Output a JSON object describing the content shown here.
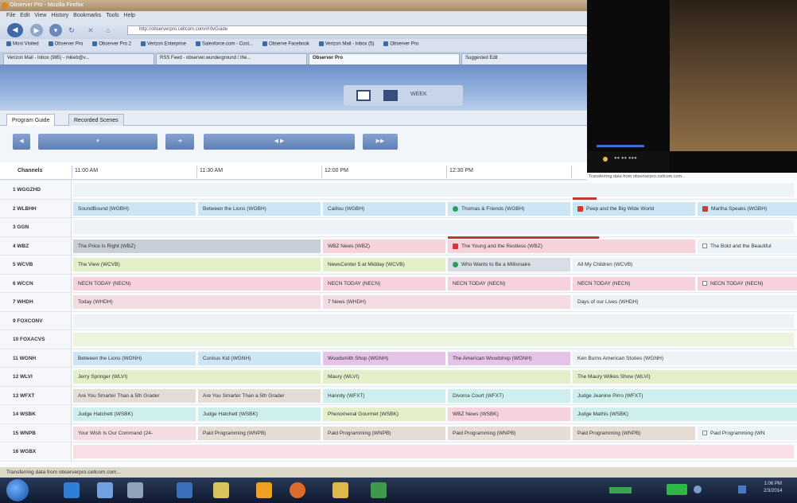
{
  "window": {
    "title": "Observer Pro - Mozilla Firefox"
  },
  "menu": [
    "File",
    "Edit",
    "View",
    "History",
    "Bookmarks",
    "Tools",
    "Help"
  ],
  "nav": {
    "url": "http://observerpro.cellcom.com/#!/tvGuide"
  },
  "bookmarks": [
    "Most Visited",
    "Observer Pro",
    "Observer Pro 2",
    "Verizon Enterprise",
    "Salesforce.com - Cust...",
    "Observe Facebook",
    "Verizon Mail - Inbox (5)",
    "Observer Pro"
  ],
  "tabs": [
    "Verizon Mail - Inbox (985) - mikeb@v...",
    "RSS Feed - observer.wunderground / the...",
    "Observer Pro",
    "Suggested Edit"
  ],
  "app": {
    "view_label": "WEEK"
  },
  "subtabs": [
    "Program Guide",
    "Recorded Scenes"
  ],
  "grid": {
    "channels_header": "Channels",
    "times": [
      "11:00 AM",
      "11:30 AM",
      "12:00 PM",
      "12:30 PM"
    ],
    "rows": [
      {
        "channel": "1 WGGZHD",
        "programs": []
      },
      {
        "channel": "2 WLBHH",
        "programs": [
          "SoundBound (WGBH)",
          "Between the Lions (WGBH)",
          "Caillou (WGBH)",
          "Thomas & Friends (WGBH)",
          "Peep and the Big Wide World",
          "Martha Speaks (WGBH)"
        ]
      },
      {
        "channel": "3 GGN",
        "programs": []
      },
      {
        "channel": "4 WBZ",
        "programs": [
          "The Price Is Right (WBZ)",
          "WBZ News (WBZ)",
          "The Young and the Restless (WBZ)",
          "The Bold and the Beautiful"
        ]
      },
      {
        "channel": "5 WCVB",
        "programs": [
          "The View (WCVB)",
          "NewsCenter 5 at Midday (WCVB)",
          "Who Wants to Be a Millionaire",
          "All My Children (WCVB)"
        ]
      },
      {
        "channel": "6 WCCN",
        "programs": [
          "NECN TODAY (NECN)",
          "NECN TODAY (NECN)",
          "NECN TODAY (NECN)",
          "NECN TODAY (NECN)",
          "NECN TODAY (NECN)"
        ]
      },
      {
        "channel": "7 WHDH",
        "programs": [
          "Today (WHDH)",
          "7 News (WHDH)",
          "Days of our Lives (WHDH)"
        ]
      },
      {
        "channel": "9 FOXCONV",
        "programs": []
      },
      {
        "channel": "10 FOXACVS",
        "programs": []
      },
      {
        "channel": "11 WGNH",
        "programs": [
          "Between the Lions (WGNH)",
          "Curious Kid (WGNH)",
          "Woodsmith Shop (WGNH)",
          "The American Woodshop (WGNH)",
          "Ken Burns American Stories (WGNH)"
        ]
      },
      {
        "channel": "12 WLVI",
        "programs": [
          "Jerry Springer (WLVI)",
          "Maury (WLVI)",
          "The Maury Wilkes Show (WLVI)"
        ]
      },
      {
        "channel": "13 WFXT",
        "programs": [
          "Are You Smarter Than a 5th Grader",
          "Are You Smarter Than a 5th Grader",
          "Hannity (WFXT)",
          "Divorce Court (WFXT)",
          "Judge Jeanine Pirro (WFXT)"
        ]
      },
      {
        "channel": "14 WSBK",
        "programs": [
          "Judge Hatchett (WSBK)",
          "Judge Hatchett (WSBK)",
          "Phenomenal Gourmet (WSBK)",
          "WBZ News (WSBK)",
          "Judge Mathis (WSBK)"
        ]
      },
      {
        "channel": "15 WNPB",
        "programs": [
          "Your Wish Is Our Command (24-",
          "Paid Programming (WNPB)",
          "Paid Programming (WNPB)",
          "Paid Programming (WNPB)",
          "Paid Programming (WNPB)",
          "Paid Programming (WN"
        ]
      },
      {
        "channel": "16 WGBX",
        "programs": []
      }
    ]
  },
  "video": {
    "caption": "Transferring data from observerpro.cellcom.com..."
  },
  "status": "Transferring data from observerpro.cellcom.com...",
  "taskbar": {
    "time": "1:06 PM",
    "date": "2/3/2014"
  },
  "colors": {
    "blue": "#cde6f5",
    "pink": "#f6d3dc",
    "green": "#e2efc9",
    "gray": "#d9dde6",
    "purple": "#e3c3e6",
    "cyan": "#cfeeee",
    "tan": "#e5dcd6",
    "accent": "#3f6aa8",
    "record": "#2f9d55"
  }
}
